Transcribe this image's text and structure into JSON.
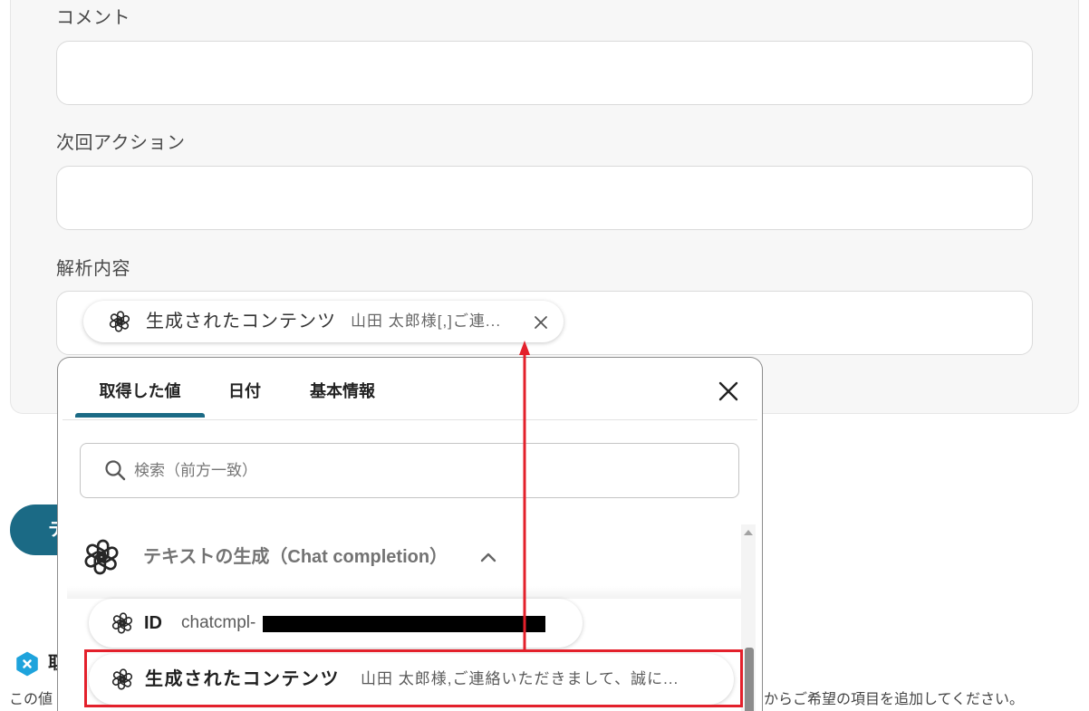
{
  "form": {
    "comment": {
      "label": "コメント",
      "value": ""
    },
    "next_action": {
      "label": "次回アクション",
      "value": ""
    },
    "analysis": {
      "label": "解析内容",
      "chip": {
        "title": "生成されたコンテンツ",
        "preview": "山田 太郎様[,]ご連...",
        "icon": "openai-icon",
        "remove_icon": "close-icon"
      }
    }
  },
  "picker": {
    "tabs": [
      {
        "label": "取得した値",
        "active": true
      },
      {
        "label": "日付",
        "active": false
      },
      {
        "label": "基本情報",
        "active": false
      }
    ],
    "close_icon": "close-icon",
    "search": {
      "placeholder": "検索（前方一致）",
      "icon": "search-icon"
    },
    "section": {
      "title": "テキストの生成（Chat completion）",
      "icon": "openai-icon",
      "toggle_icon": "chevron-up-icon",
      "expanded": true
    },
    "items": [
      {
        "label": "ID",
        "value": "chatcmpl-",
        "value_redacted": true,
        "icon": "openai-icon"
      },
      {
        "label": "生成されたコンテンツ",
        "value": "山田 太郎様,ご連絡いただきまして、誠に...",
        "icon": "openai-icon",
        "highlighted": true
      }
    ]
  },
  "behind_picker": {
    "button_label": "テ",
    "help_icon": "hexagon-x-icon",
    "help_heading": "取",
    "help_text_start": "この値",
    "help_text_end": "からご希望の項目を追加してください。"
  },
  "colors": {
    "accent": "#1b6a85",
    "annotation": "#e3202b",
    "help_icon": "#1ea3dc"
  }
}
